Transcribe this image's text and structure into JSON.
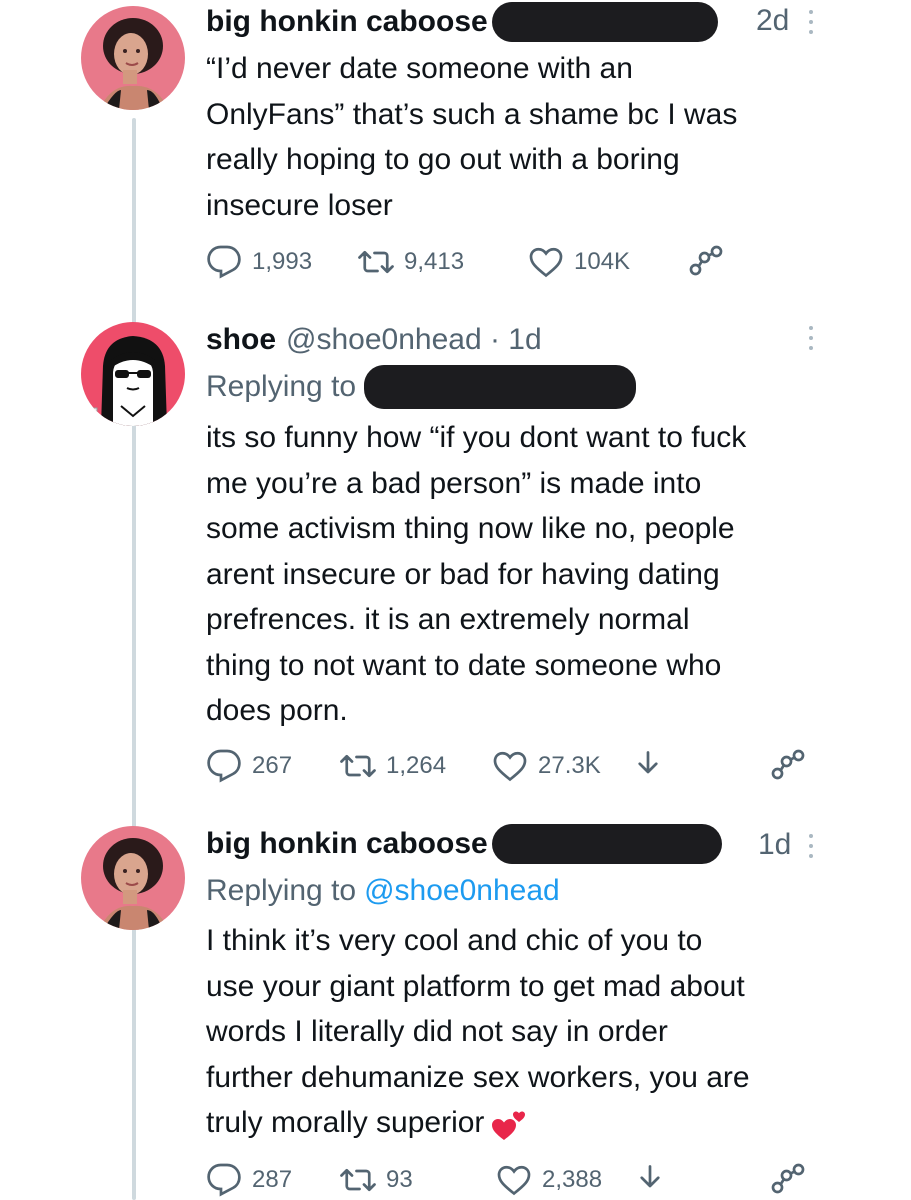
{
  "tweets": [
    {
      "name": "big honkin caboose",
      "handle": "",
      "time": "2d",
      "replying_to": "",
      "lines": [
        "“I’d never date someone with an",
        "OnlyFans” that’s such a shame bc I was",
        "really hoping to go out with a boring",
        "insecure loser"
      ],
      "replies": "1,993",
      "retweets": "9,413",
      "likes": "104K"
    },
    {
      "name": "shoe",
      "handle": "@shoe0nhead · 1d",
      "time": "",
      "replying_label": "Replying to",
      "lines": [
        "its so funny how “if you dont want to fuck",
        "me you’re a bad person” is made into",
        "some activism thing now like no, people",
        "arent insecure or bad for having dating",
        "prefrences. it is an extremely normal",
        "thing to not want to date someone who",
        "does porn."
      ],
      "replies": "267",
      "retweets": "1,264",
      "likes": "27.3K"
    },
    {
      "name": "big honkin caboose",
      "time": "1d",
      "replying_label": "Replying to",
      "replying_to": "@shoe0nhead",
      "lines": [
        "I think it’s very cool and chic of you to",
        "use your giant platform to get mad about",
        "words I literally did not say in order",
        "further dehumanize sex workers, you are",
        "truly morally superior"
      ],
      "replies": "287",
      "retweets": "93",
      "likes": "2,388"
    }
  ],
  "colors": {
    "text": "#0f1419",
    "secondary": "#536471",
    "link": "#1d9bf0",
    "thread_line": "#cfd9de",
    "redaction": "#1c1c1f",
    "avatar_bg": "#e8798a",
    "emoji": "#e8264a"
  },
  "icons": {
    "reply": "reply-icon",
    "retweet": "retweet-icon",
    "like": "heart-icon",
    "share": "share-icon",
    "bookmark": "download-icon",
    "more": "more-icon",
    "emoji": "two-hearts-emoji"
  }
}
